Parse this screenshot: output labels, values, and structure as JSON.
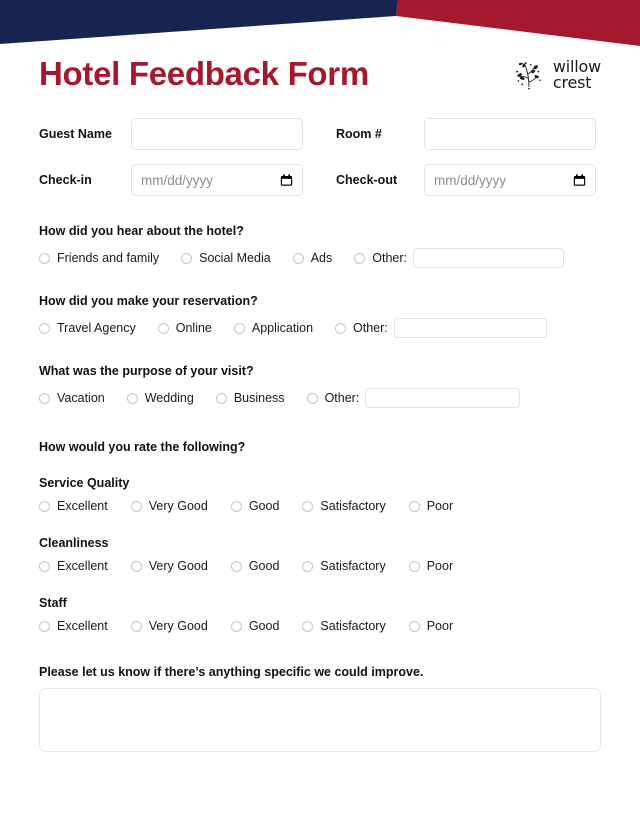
{
  "header": {
    "title": "Hotel Feedback Form",
    "title_color": "#a4192d",
    "navy_color": "#17244f",
    "red_color": "#a4192d",
    "logo": {
      "icon": "botanical-sprig-icon",
      "line1": "willow",
      "line2": "crest"
    }
  },
  "fields": {
    "guest_name": {
      "label": "Guest Name",
      "value": "",
      "placeholder": ""
    },
    "room_number": {
      "label": "Room #",
      "value": "",
      "placeholder": ""
    },
    "check_in": {
      "label": "Check-in",
      "value": "",
      "placeholder": "mm/dd/yyyy",
      "icon": "calendar-icon"
    },
    "check_out": {
      "label": "Check-out",
      "value": "",
      "placeholder": "mm/dd/yyyy",
      "icon": "calendar-icon"
    }
  },
  "questions": [
    {
      "id": "hear-about",
      "title": "How did you hear about the hotel?",
      "options": [
        "Friends and family",
        "Social Media",
        "Ads"
      ],
      "other_label": "Other:",
      "other_value": "",
      "other_width": 151
    },
    {
      "id": "reservation-method",
      "title": "How did you make your reservation?",
      "options": [
        "Travel Agency",
        "Online",
        "Application"
      ],
      "other_label": "Other:",
      "other_value": "",
      "other_width": 153
    },
    {
      "id": "visit-purpose",
      "title": "What was the purpose of your visit?",
      "options": [
        "Vacation",
        "Wedding",
        "Business"
      ],
      "other_label": "Other:",
      "other_value": "",
      "other_width": 155
    }
  ],
  "ratings": {
    "heading": "How would you rate the following?",
    "scale": [
      "Excellent",
      "Very Good",
      "Good",
      "Satisfactory",
      "Poor"
    ],
    "items": [
      "Service Quality",
      "Cleanliness",
      "Staff"
    ]
  },
  "comments": {
    "label": "Please let us know if there’s anything specific we could improve.",
    "value": "",
    "placeholder": ""
  }
}
